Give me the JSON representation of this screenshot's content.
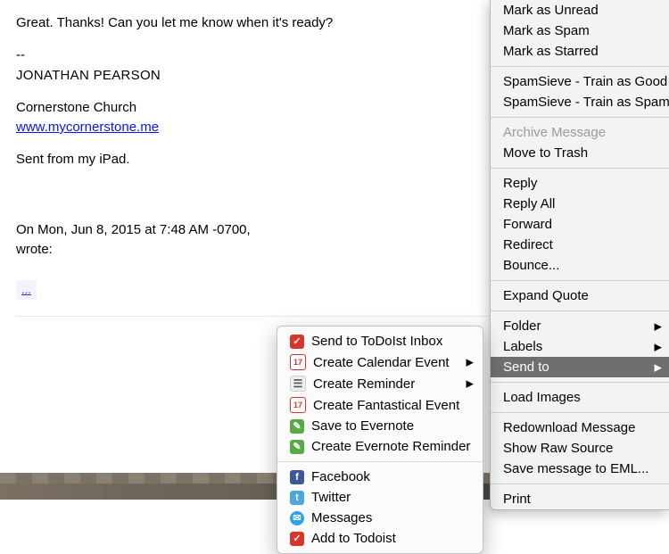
{
  "email": {
    "line1": "Great. Thanks! Can you let me know when it's ready?",
    "dashes": "--",
    "sig_name": "JONATHAN PEARSON",
    "sig_org": "Cornerstone Church",
    "sig_link": "www.mycornerstone.me",
    "sent_from": "Sent from my iPad.",
    "quote_header": "On Mon, Jun 8, 2015 at 7:48 AM -0700,",
    "wrote": "wrote:",
    "ellipsis": "..."
  },
  "context_menu": {
    "mark_unread": "Mark as Unread",
    "mark_spam": "Mark as Spam",
    "mark_starred": "Mark as Starred",
    "ss_good": "SpamSieve - Train as Good",
    "ss_spam": "SpamSieve - Train as Spam",
    "archive": "Archive Message",
    "trash": "Move to Trash",
    "reply": "Reply",
    "reply_all": "Reply All",
    "forward": "Forward",
    "redirect": "Redirect",
    "bounce": "Bounce...",
    "expand_quote": "Expand Quote",
    "folder": "Folder",
    "labels": "Labels",
    "send_to": "Send to",
    "load_images": "Load Images",
    "redownload": "Redownload Message",
    "raw_source": "Show Raw Source",
    "save_eml": "Save message to EML...",
    "print": "Print"
  },
  "submenu": {
    "todoist_inbox": "Send to ToDoIst Inbox",
    "calendar": "Create Calendar Event",
    "reminder": "Create Reminder",
    "fantastical": "Create Fantastical Event",
    "evernote": "Save to Evernote",
    "evernote_rem": "Create Evernote Reminder",
    "facebook": "Facebook",
    "twitter": "Twitter",
    "messages": "Messages",
    "add_todoist": "Add to Todoist"
  }
}
